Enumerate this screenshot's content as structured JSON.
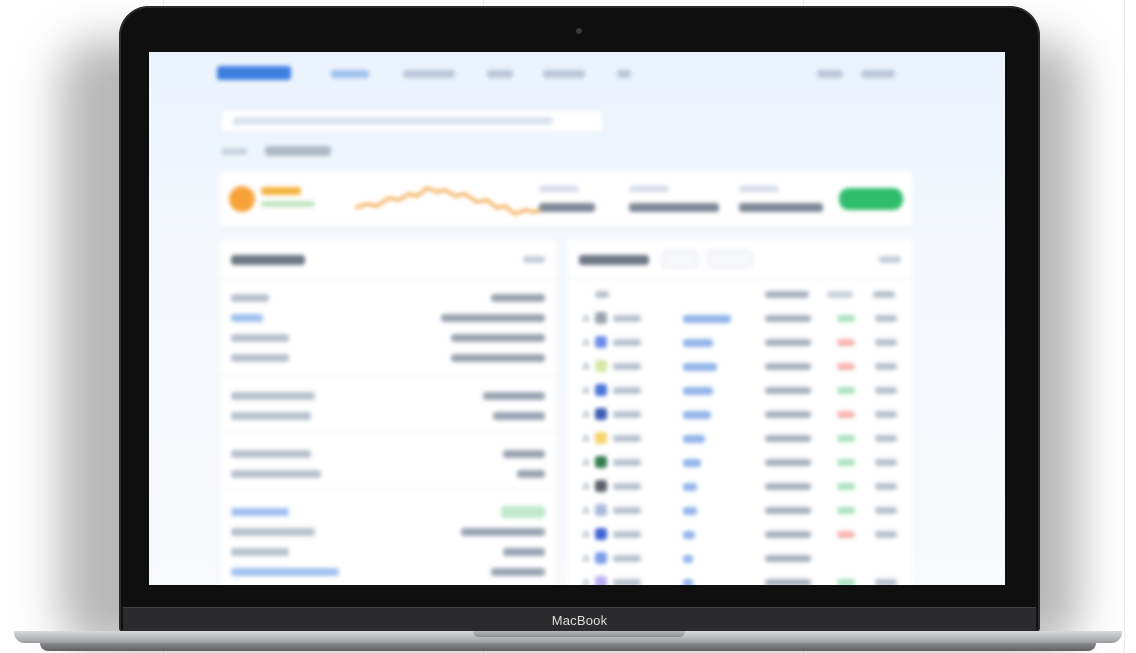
{
  "laptop": {
    "brand": "MacBook"
  },
  "screen_page": {
    "description_hidden": "",
    "ticker": {
      "coin_color": "#f7a33a",
      "action_color": "#2fbd6c"
    },
    "colors": {
      "accent": "#3c7fe0",
      "positive": "#2fbd6c",
      "negative": "#f06b6b",
      "link": "#8fb3ea"
    },
    "table": {
      "rows": [
        {
          "icon_color": "#9aa3ad",
          "change": "positive"
        },
        {
          "icon_color": "#6b8de8",
          "change": "negative"
        },
        {
          "icon_color": "#d6e8a8",
          "change": "negative"
        },
        {
          "icon_color": "#4a72d8",
          "change": "positive"
        },
        {
          "icon_color": "#3a5cb0",
          "change": "negative"
        },
        {
          "icon_color": "#f6d36a",
          "change": "positive"
        },
        {
          "icon_color": "#2f7a4e",
          "change": "positive"
        },
        {
          "icon_color": "#5a5f68",
          "change": "positive"
        },
        {
          "icon_color": "#a9b9d6",
          "change": "positive"
        },
        {
          "icon_color": "#3f63d6",
          "change": "negative"
        },
        {
          "icon_color": "#7b9ce9",
          "change": "none"
        },
        {
          "icon_color": "#b9aef0",
          "change": "positive"
        }
      ]
    }
  }
}
